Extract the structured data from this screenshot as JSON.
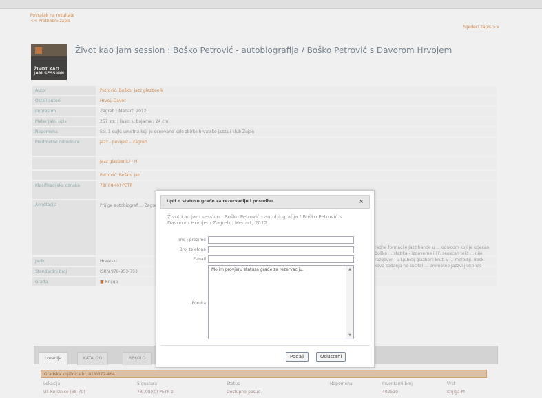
{
  "header": {
    "back_links": [
      "Povratak na rezultate",
      "<< Prethodni zapis"
    ],
    "next_link": "Sljedeći zapis >>"
  },
  "record": {
    "title": "Život kao jam session : Boško Petrović - autobiografija / Boško Petrović s Davorom Hrvojem",
    "cover_text": "ŽIVOT KAO\nJAM SESSION",
    "rows": [
      {
        "label": "Autor",
        "value": "Petrović, Boško, jazz glazbenik",
        "link": true
      },
      {
        "label": "Ostali autori",
        "value": "Hrvoj, Davor",
        "link": true
      },
      {
        "label": "Impresum",
        "value": "Zagreb : Menart, 2012",
        "link": false
      },
      {
        "label": "Materijalni opis",
        "value": "257 str. : ilustr. u bojama ; 24 cm",
        "link": false
      },
      {
        "label": "Napomena",
        "value": "Str. 1 oujk: umetna koji je osnovano kole zbirke hrvatsko jazza i klub Zujan",
        "link": false
      },
      {
        "label": "Predmetne odrednice",
        "value": "Jazz - povijest - Zagreb",
        "link": true
      },
      {
        "label": "",
        "value": "Jazz glazbenici - H",
        "link": true
      },
      {
        "label": "",
        "value": "Petrović, Boško, jaz",
        "link": true
      },
      {
        "label": "Klasifikacijska oznaka",
        "value": "78(.08)(0) PETR",
        "link": true
      },
      {
        "label": "Annotacija",
        "value": "Prijige autobiograf ... Zagrebu, Autorove ... sadanja je bi zbir ... bitnog skuplijen ... Streljacu, redanj ... i muzičkarge a riesi",
        "link": false
      },
      {
        "label": "Jezik",
        "value": "Hrvatski",
        "link": false
      },
      {
        "label": "Standardni broj",
        "value": "ISBN 978-953-753",
        "link": false
      },
      {
        "label": "Građa",
        "value": "Knjiga",
        "link": false
      }
    ],
    "right_text": "radne formacije jazz bande u ... odnicom koji je utjecao Boška ... statika - izdaverne ili F. seoscan tekt ... nije razgovor i u Ljubicij glazbeni kruti v ... melodiji. Bosk kova sadanja ne sucitel ... prometne jazzvlij ukrinos"
  },
  "tabs": [
    "Lokacija",
    "KATALOG",
    "RBKOLO"
  ],
  "availability": {
    "bar": "Gradska knjižnica br. 01/0372-464",
    "columns": [
      "Lokacija",
      "Signatura",
      "Status",
      "Napomena",
      "Inventarni broj",
      "Vrst"
    ],
    "row": [
      "Ul. Knjižnice (58-70)",
      "78(.08)(0) PETR z",
      "Dostupno-posuđ",
      "",
      "402510",
      "Knjiga-M"
    ]
  },
  "dialog": {
    "title": "Upit o statusu građe za rezervaciju i posudbu",
    "close": "×",
    "description": "Život kao jam session : Boško Petrović - autobiografija / Boško Petrović s Davorom Hrvojem Zagreb : Menart, 2012",
    "fields": {
      "name_label": "Ime i prezime",
      "phone_label": "Broj telefona",
      "email_label": "E-mail",
      "message_label": "Poruka",
      "message_value": "Molim provjeru statusa građe za rezervaciju."
    },
    "buttons": {
      "submit": "Podaji",
      "cancel": "Odustani"
    }
  }
}
